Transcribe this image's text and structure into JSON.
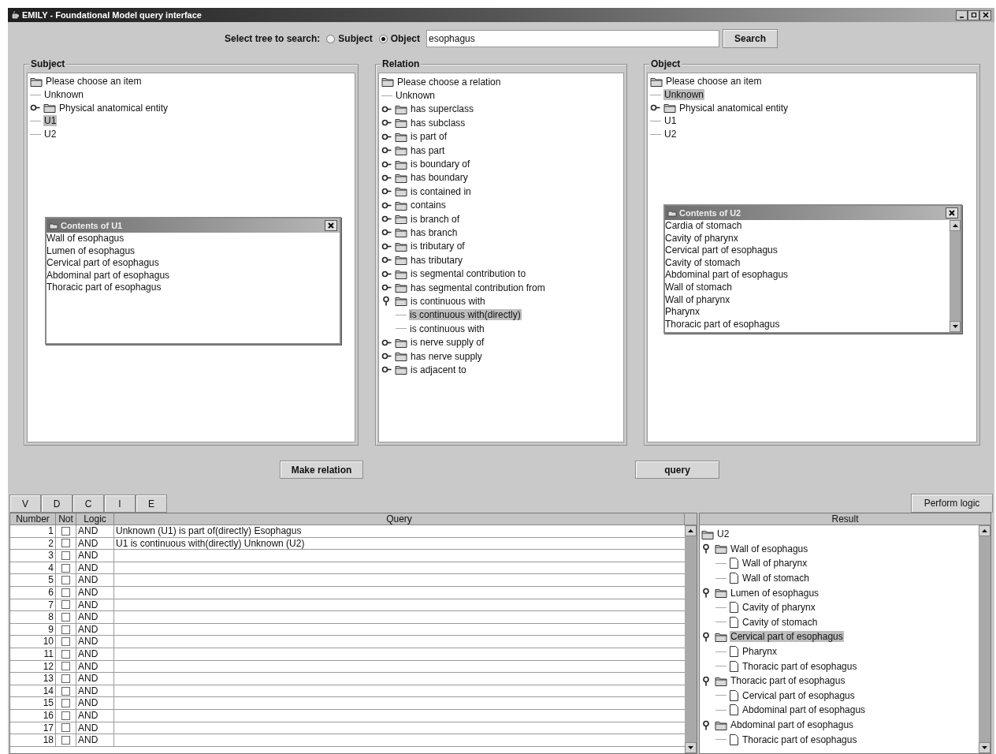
{
  "window": {
    "title": "EMILY - Foundational Model query interface"
  },
  "search": {
    "label": "Select tree to search:",
    "options": [
      {
        "label": "Subject",
        "selected": false
      },
      {
        "label": "Object",
        "selected": true
      }
    ],
    "value": "esophagus",
    "button": "Search"
  },
  "panels": [
    {
      "title": "Subject",
      "tree": [
        {
          "label": "Please choose an item",
          "kind": "folder",
          "selected": false,
          "children": [
            {
              "label": "Unknown",
              "kind": "leaf",
              "selected": false
            },
            {
              "label": "Physical anatomical entity",
              "kind": "folder",
              "expanded": false,
              "selected": false
            },
            {
              "label": "U1",
              "kind": "leaf",
              "selected": true
            },
            {
              "label": "U2",
              "kind": "leaf",
              "selected": false
            }
          ]
        }
      ],
      "contents": {
        "title": "Contents of U1",
        "scrollbar": false,
        "items": [
          "Wall of esophagus",
          "Lumen of esophagus",
          "Cervical part of esophagus",
          "Abdominal part of esophagus",
          "Thoracic part of esophagus"
        ]
      }
    },
    {
      "title": "Relation",
      "tree": [
        {
          "label": "Please choose a relation",
          "kind": "folder",
          "selected": false,
          "children": [
            {
              "label": "Unknown",
              "kind": "leaf",
              "selected": false
            },
            {
              "label": "has superclass",
              "kind": "folder",
              "expanded": false,
              "selected": false
            },
            {
              "label": "has subclass",
              "kind": "folder",
              "expanded": false,
              "selected": false
            },
            {
              "label": "is part of",
              "kind": "folder",
              "expanded": false,
              "selected": false
            },
            {
              "label": "has part",
              "kind": "folder",
              "expanded": false,
              "selected": false
            },
            {
              "label": "is boundary of",
              "kind": "folder",
              "expanded": false,
              "selected": false
            },
            {
              "label": "has boundary",
              "kind": "folder",
              "expanded": false,
              "selected": false
            },
            {
              "label": "is contained in",
              "kind": "folder",
              "expanded": false,
              "selected": false
            },
            {
              "label": "contains",
              "kind": "folder",
              "expanded": false,
              "selected": false
            },
            {
              "label": "is branch of",
              "kind": "folder",
              "expanded": false,
              "selected": false
            },
            {
              "label": "has branch",
              "kind": "folder",
              "expanded": false,
              "selected": false
            },
            {
              "label": "is tributary of",
              "kind": "folder",
              "expanded": false,
              "selected": false
            },
            {
              "label": "has tributary",
              "kind": "folder",
              "expanded": false,
              "selected": false
            },
            {
              "label": "is segmental contribution to",
              "kind": "folder",
              "expanded": false,
              "selected": false
            },
            {
              "label": "has segmental contribution from",
              "kind": "folder",
              "expanded": false,
              "selected": false
            },
            {
              "label": "is continuous with",
              "kind": "folder",
              "expanded": true,
              "selected": false,
              "children": [
                {
                  "label": "is continuous with(directly)",
                  "kind": "leaf",
                  "selected": true
                },
                {
                  "label": "is continuous with",
                  "kind": "leaf",
                  "selected": false
                }
              ]
            },
            {
              "label": "is nerve supply of",
              "kind": "folder",
              "expanded": false,
              "selected": false
            },
            {
              "label": "has nerve supply",
              "kind": "folder",
              "expanded": false,
              "selected": false
            },
            {
              "label": "is adjacent to",
              "kind": "folder",
              "expanded": false,
              "selected": false
            }
          ]
        }
      ]
    },
    {
      "title": "Object",
      "tree": [
        {
          "label": "Please choose an item",
          "kind": "folder",
          "selected": false,
          "children": [
            {
              "label": "Unknown",
              "kind": "leaf",
              "selected": true
            },
            {
              "label": "Physical anatomical entity",
              "kind": "folder",
              "expanded": false,
              "selected": false
            },
            {
              "label": "U1",
              "kind": "leaf",
              "selected": false
            },
            {
              "label": "U2",
              "kind": "leaf",
              "selected": false
            }
          ]
        }
      ],
      "contents": {
        "title": "Contents of U2",
        "scrollbar": true,
        "items": [
          "Cardia of stomach",
          "Cavity of pharynx",
          "Cervical part of esophagus",
          "Cavity of stomach",
          "Abdominal part of esophagus",
          "Wall of stomach",
          "Wall of pharynx",
          "Pharynx",
          "Thoracic part of esophagus"
        ]
      }
    }
  ],
  "actions": [
    "Make relation",
    "query"
  ],
  "tool_buttons": [
    "V",
    "D",
    "C",
    "I",
    "E"
  ],
  "perform_button": "Perform logic",
  "table": {
    "columns": [
      "Number",
      "Not",
      "Logic",
      "Query"
    ],
    "rows": [
      {
        "number": "1",
        "not": false,
        "logic": "AND",
        "query": "Unknown (U1) is part of(directly) Esophagus"
      },
      {
        "number": "2",
        "not": false,
        "logic": "AND",
        "query": "U1 is continuous with(directly) Unknown (U2)"
      },
      {
        "number": "3",
        "not": false,
        "logic": "AND"
      },
      {
        "number": "4",
        "not": false,
        "logic": "AND"
      },
      {
        "number": "5",
        "not": false,
        "logic": "AND"
      },
      {
        "number": "6",
        "not": false,
        "logic": "AND"
      },
      {
        "number": "7",
        "not": false,
        "logic": "AND"
      },
      {
        "number": "8",
        "not": false,
        "logic": "AND"
      },
      {
        "number": "9",
        "not": false,
        "logic": "AND"
      },
      {
        "number": "10",
        "not": false,
        "logic": "AND"
      },
      {
        "number": "11",
        "not": false,
        "logic": "AND"
      },
      {
        "number": "12",
        "not": false,
        "logic": "AND"
      },
      {
        "number": "13",
        "not": false,
        "logic": "AND"
      },
      {
        "number": "14",
        "not": false,
        "logic": "AND"
      },
      {
        "number": "15",
        "not": false,
        "logic": "AND"
      },
      {
        "number": "16",
        "not": false,
        "logic": "AND"
      },
      {
        "number": "17",
        "not": false,
        "logic": "AND"
      },
      {
        "number": "18",
        "not": false,
        "logic": "AND"
      }
    ]
  },
  "result": {
    "column": "Result",
    "tree": [
      {
        "label": "U2",
        "kind": "folder",
        "selected": false,
        "children": [
          {
            "label": "Wall of esophagus",
            "kind": "folder",
            "expanded": true,
            "selected": false,
            "children": [
              {
                "label": "Wall of pharynx",
                "kind": "document",
                "selected": false
              },
              {
                "label": "Wall of stomach",
                "kind": "document",
                "selected": false
              }
            ]
          },
          {
            "label": "Lumen of esophagus",
            "kind": "folder",
            "expanded": true,
            "selected": false,
            "children": [
              {
                "label": "Cavity of pharynx",
                "kind": "document",
                "selected": false
              },
              {
                "label": "Cavity of stomach",
                "kind": "document",
                "selected": false
              }
            ]
          },
          {
            "label": "Cervical part of esophagus",
            "kind": "folder",
            "expanded": true,
            "selected": true,
            "children": [
              {
                "label": "Pharynx",
                "kind": "document",
                "selected": false
              },
              {
                "label": "Thoracic part of esophagus",
                "kind": "document",
                "selected": false
              }
            ]
          },
          {
            "label": "Thoracic part of esophagus",
            "kind": "folder",
            "expanded": true,
            "selected": false,
            "children": [
              {
                "label": "Cervical part of esophagus",
                "kind": "document",
                "selected": false
              },
              {
                "label": "Abdominal part of esophagus",
                "kind": "document",
                "selected": false
              }
            ]
          },
          {
            "label": "Abdominal part of esophagus",
            "kind": "folder",
            "expanded": true,
            "selected": false,
            "children": [
              {
                "label": "Thoracic part of esophagus",
                "kind": "document",
                "selected": false
              }
            ]
          }
        ]
      }
    ]
  }
}
